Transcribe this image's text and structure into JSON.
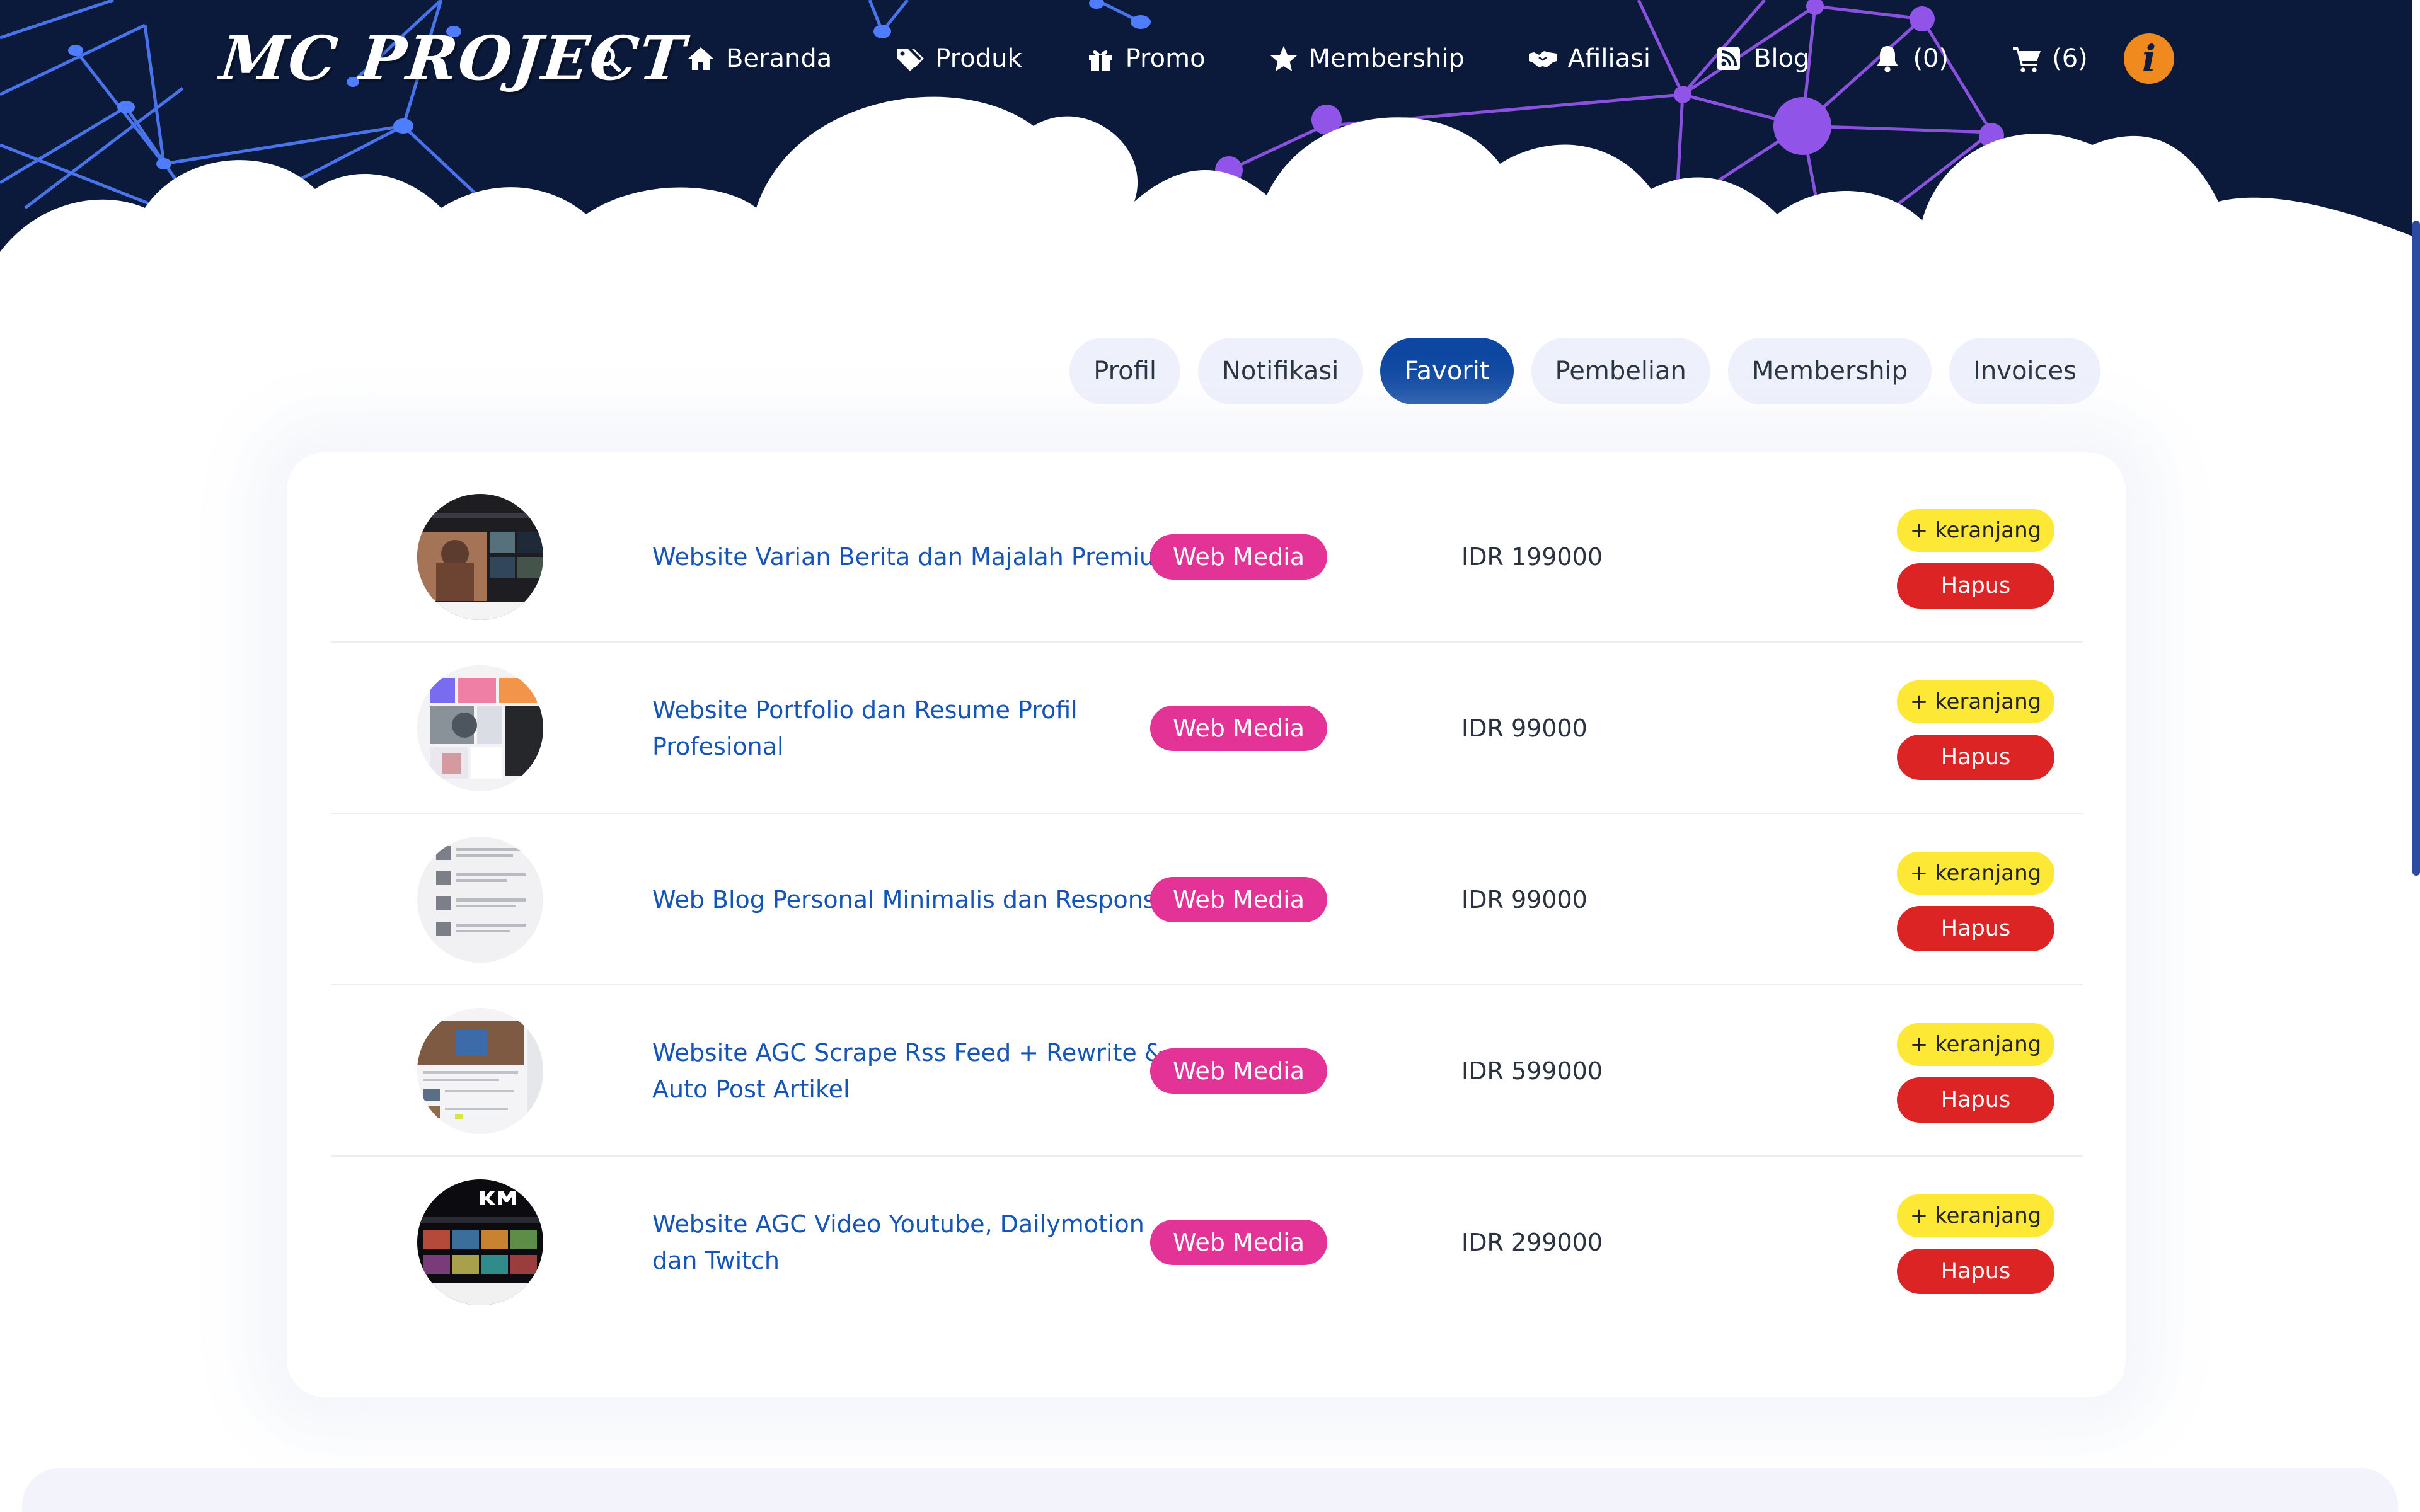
{
  "brand": {
    "logo_text": "MC PROJECT"
  },
  "nav": {
    "search_icon": "search-icon",
    "items": [
      {
        "label": "Beranda",
        "icon": "home-icon"
      },
      {
        "label": "Produk",
        "icon": "tags-icon"
      },
      {
        "label": "Promo",
        "icon": "gift-icon"
      },
      {
        "label": "Membership",
        "icon": "star-icon"
      },
      {
        "label": "Afiliasi",
        "icon": "handshake-icon"
      },
      {
        "label": "Blog",
        "icon": "rss-icon"
      },
      {
        "label": "(0)",
        "icon": "bell-icon"
      },
      {
        "label": "(6)",
        "icon": "cart-icon"
      }
    ],
    "info_label": "i"
  },
  "tabs": [
    {
      "label": "Profil",
      "active": false
    },
    {
      "label": "Notifikasi",
      "active": false
    },
    {
      "label": "Favorit",
      "active": true
    },
    {
      "label": "Pembelian",
      "active": false
    },
    {
      "label": "Membership",
      "active": false
    },
    {
      "label": "Invoices",
      "active": false
    }
  ],
  "favorites": [
    {
      "title": "Website Varian Berita dan Majalah Premium",
      "category": "Web Media",
      "price": "IDR 199000",
      "add_label": "+ keranjang",
      "remove_label": "Hapus"
    },
    {
      "title": "Website Portfolio dan Resume Profil Profesional",
      "category": "Web Media",
      "price": "IDR 99000",
      "add_label": "+ keranjang",
      "remove_label": "Hapus"
    },
    {
      "title": "Web Blog Personal Minimalis dan Responsif",
      "category": "Web Media",
      "price": "IDR 99000",
      "add_label": "+ keranjang",
      "remove_label": "Hapus"
    },
    {
      "title": "Website AGC Scrape Rss Feed + Rewrite & Auto Post Artikel",
      "category": "Web Media",
      "price": "IDR 599000",
      "add_label": "+ keranjang",
      "remove_label": "Hapus"
    },
    {
      "title": "Website AGC Video Youtube, Dailymotion dan Twitch",
      "category": "Web Media",
      "price": "IDR 299000",
      "add_label": "+ keranjang",
      "remove_label": "Hapus"
    }
  ],
  "colors": {
    "header_bg": "#0b1a3a",
    "active_tab": "#0d47a1",
    "badge": "#e33396",
    "add_button": "#fde835",
    "remove_button": "#dd2424",
    "link": "#1555b7",
    "info_button": "#f18a1e"
  }
}
